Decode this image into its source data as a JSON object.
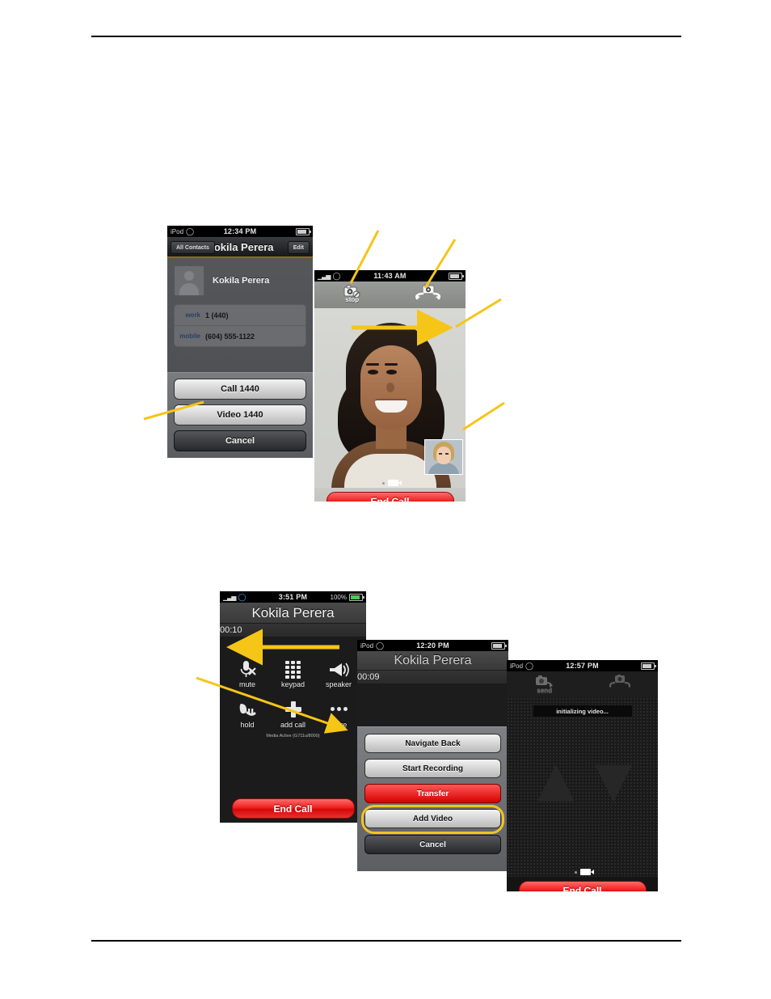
{
  "document": {
    "header_rule": true,
    "footer_rule": true
  },
  "figure_top": {
    "contact_screen": {
      "status": {
        "carrier": "iPod",
        "wifi_icon": "wifi-icon",
        "time": "12:34 PM",
        "battery_icon": "battery-icon"
      },
      "navbar": {
        "back_label": "All Contacts",
        "title": "Kokila Perera",
        "edit_label": "Edit"
      },
      "contact_name": "Kokila Perera",
      "avatar_icon": "person-placeholder-icon",
      "fields": [
        {
          "label": "work",
          "value": "1 (440)"
        },
        {
          "label": "mobile",
          "value": "(604) 555-1122"
        }
      ],
      "actions": [
        {
          "label": "Call 1440",
          "style": "light"
        },
        {
          "label": "Video 1440",
          "style": "light"
        },
        {
          "label": "Cancel",
          "style": "dark"
        }
      ]
    },
    "video_screen": {
      "status": {
        "carrier_bars_icon": "signal-bars-icon",
        "wifi_icon": "wifi-icon",
        "time": "11:43 AM",
        "battery_icon": "battery-icon"
      },
      "toolbar": [
        {
          "icon": "camera-stop-icon",
          "label": "stop"
        },
        {
          "icon": "camera-swap-icon",
          "label": ""
        }
      ],
      "far_end_video": "remote-video-feed",
      "near_end_video": "local-video-preview",
      "page_indicator_icon": "video-page-indicator-icon",
      "end_call_label": "End Call"
    }
  },
  "figure_bottom": {
    "incall_screen": {
      "status": {
        "carrier_bars_icon": "signal-bars-icon",
        "wifi_icon": "wifi-icon",
        "time": "3:51 PM",
        "battery_percent": "100%",
        "battery_icon": "battery-icon"
      },
      "call_name": "Kokila Perera",
      "timer": "00:10",
      "buttons": [
        {
          "icon": "mute-icon",
          "label": "mute"
        },
        {
          "icon": "keypad-icon",
          "label": "keypad"
        },
        {
          "icon": "speaker-icon",
          "label": "speaker"
        },
        {
          "icon": "hold-icon",
          "label": "hold"
        },
        {
          "icon": "add-call-icon",
          "label": "add call"
        },
        {
          "icon": "more-dots-icon",
          "label": "more"
        }
      ],
      "media_status": "Media Active (G711u/8000)",
      "end_call_label": "End Call"
    },
    "sheet_screen": {
      "status": {
        "carrier": "iPod",
        "wifi_icon": "wifi-icon",
        "time": "12:20 PM",
        "battery_icon": "battery-icon"
      },
      "call_name": "Kokila Perera",
      "timer": "00:09",
      "menu": [
        {
          "label": "Navigate Back",
          "style": "light"
        },
        {
          "label": "Start Recording",
          "style": "light"
        },
        {
          "label": "Transfer",
          "style": "red"
        },
        {
          "label": "Add Video",
          "style": "light",
          "highlighted": true
        },
        {
          "label": "Cancel",
          "style": "dark"
        }
      ],
      "highlight_color": "#f0c420"
    },
    "init_screen": {
      "status": {
        "carrier": "iPod",
        "wifi_icon": "wifi-icon",
        "time": "12:57 PM",
        "battery_icon": "battery-icon"
      },
      "toolbar": [
        {
          "icon": "camera-send-icon",
          "label": "send"
        },
        {
          "icon": "camera-swap-icon",
          "label": ""
        }
      ],
      "message": "initializing video...",
      "page_indicator_icon": "video-page-indicator-icon",
      "end_call_label": "End Call"
    }
  },
  "annotations": {
    "arrow_color": "#f5c518",
    "items": [
      {
        "name": "arrow-to-video-button",
        "target": "Video 1440"
      },
      {
        "name": "arrow-to-stop-camera",
        "target": "stop"
      },
      {
        "name": "arrow-to-swap-camera",
        "target": "camera-swap-icon"
      },
      {
        "name": "arrow-to-remote-video",
        "target": "far end video"
      },
      {
        "name": "arrow-to-local-video",
        "target": "near end video"
      },
      {
        "name": "arrow-to-call-panel",
        "target": "in-call panel"
      },
      {
        "name": "arrow-to-more-button",
        "target": "more"
      }
    ]
  }
}
